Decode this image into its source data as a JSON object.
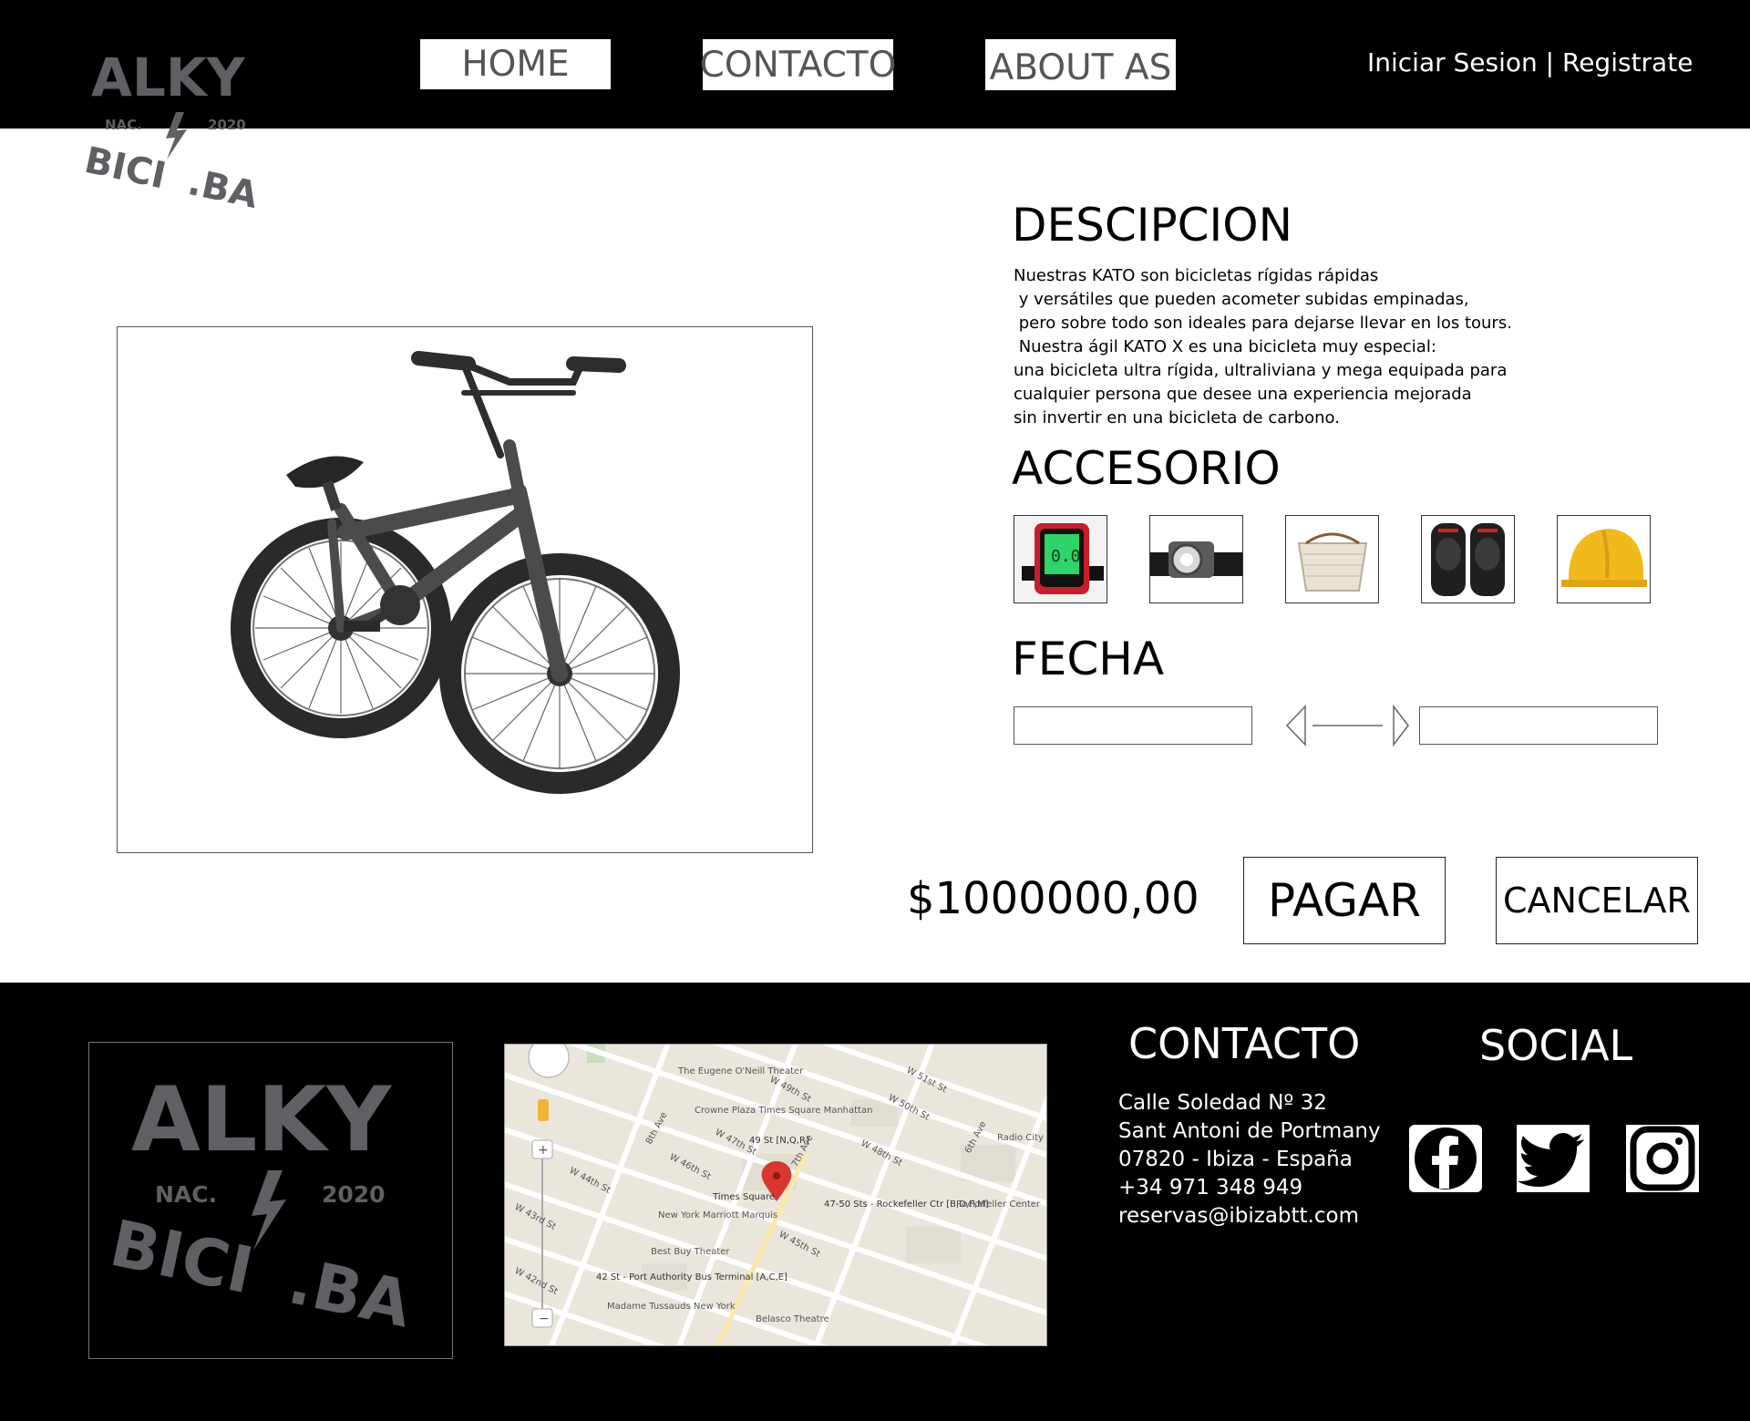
{
  "header": {
    "logo": {
      "line1": "ALKY",
      "left_tag": "NAC.",
      "right_tag": "2020",
      "line2": "BICI",
      "suffix": ".BA"
    },
    "nav": [
      {
        "label": "HOME"
      },
      {
        "label": "CONTACTO"
      },
      {
        "label": "ABOUT AS"
      }
    ],
    "auth_label": "Iniciar Sesion | Registrate"
  },
  "product": {
    "image_icon": "bmx-bicycle-image"
  },
  "description": {
    "title": "DESCIPCION",
    "text": "Nuestras KATO son bicicletas rígidas rápidas\n y versátiles que pueden acometer subidas empinadas,\n pero sobre todo son ideales para dejarse llevar en los tours.\n Nuestra ágil KATO X es una bicicleta muy especial:\nuna bicicleta ultra rígida, ultraliviana y mega equipada para\ncualquier persona que desee una experiencia mejorada\nsin invertir en una bicicleta de carbono."
  },
  "accessories": {
    "title": "ACCESORIO",
    "items": [
      {
        "icon": "bike-computer-icon",
        "color": "#2fd36a"
      },
      {
        "icon": "bike-light-icon",
        "color": "#6a6a6a"
      },
      {
        "icon": "basket-icon",
        "color": "#e8e2d4"
      },
      {
        "icon": "knee-pads-icon",
        "color": "#1f1f1f"
      },
      {
        "icon": "helmet-icon",
        "color": "#f2b91d"
      }
    ]
  },
  "date": {
    "title": "FECHA",
    "start_value": "",
    "end_value": ""
  },
  "checkout": {
    "price": "$1000000,00",
    "pay_label": "PAGAR",
    "cancel_label": "CANCELAR"
  },
  "footer": {
    "logo": {
      "line1": "ALKY",
      "left_tag": "NAC.",
      "right_tag": "2020",
      "line2": "BICI",
      "suffix": ".BA"
    },
    "map": {
      "labels": [
        "The Eugene O'Neill Theater",
        "Crowne Plaza Times Square Manhattan",
        "49 St [N,Q,R]",
        "W 47th St",
        "W 46th St",
        "W 45th St",
        "W 44th St",
        "W 43rd St",
        "W 42nd St",
        "W 49th St",
        "W 50th St",
        "W 51st St",
        "W 48th St",
        "8th Ave",
        "7th Ave",
        "6th Ave",
        "Times Square",
        "New York Marriott Marquis",
        "47-50 Sts - Rockefeller Ctr [B,D,F,M]",
        "Rockefeller Center",
        "Radio City",
        "Best Buy Theater",
        "42 St - Port Authority Bus Terminal [A,C,E]",
        "Madame Tussauds New York",
        "Belasco Theatre"
      ]
    },
    "contact": {
      "title": "CONTACTO",
      "lines": [
        "Calle Soledad Nº 32",
        "Sant Antoni de Portmany",
        "07820 - Ibiza - España",
        "+34 971 348 949",
        "reservas@ibizabtt.com"
      ]
    },
    "social": {
      "title": "SOCIAL",
      "icons": [
        "facebook-icon",
        "twitter-icon",
        "instagram-icon"
      ]
    }
  }
}
